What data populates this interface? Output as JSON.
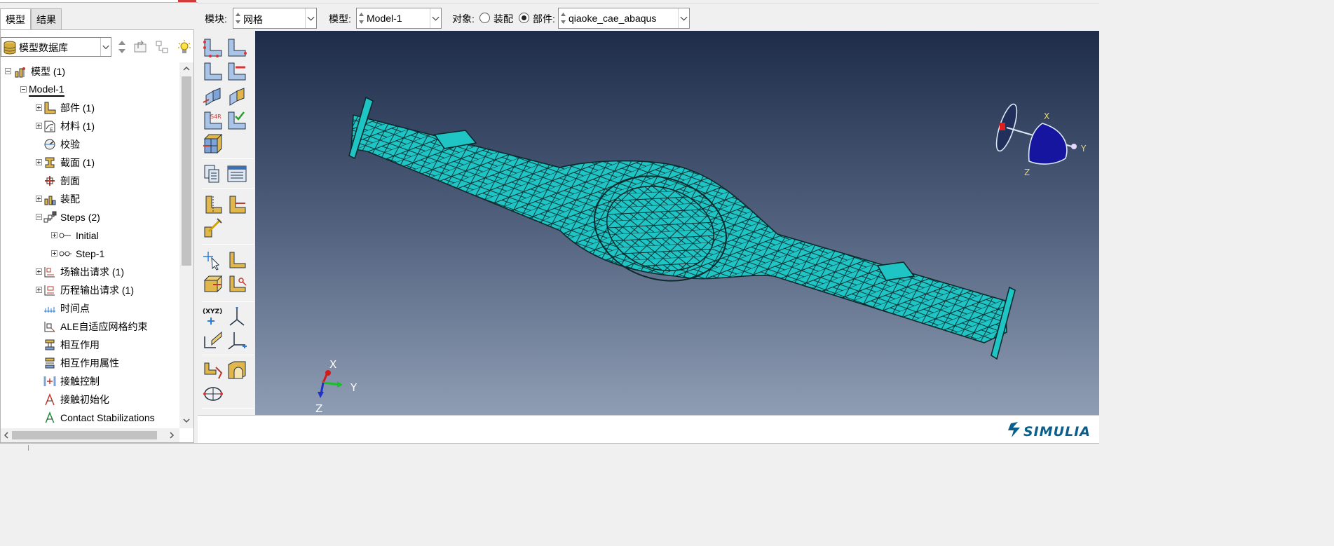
{
  "left_tabs": [
    {
      "label": "模型",
      "active": true
    },
    {
      "label": "结果",
      "active": false
    }
  ],
  "model_db": {
    "label": "模型数据库"
  },
  "tree": {
    "items": [
      {
        "label": "模型 (1)",
        "icon": "models-icon",
        "toggle": "minus"
      },
      {
        "label": "Model-1",
        "icon": "",
        "toggle": "minus"
      },
      {
        "label": "部件 (1)",
        "icon": "parts-icon",
        "toggle": "plus"
      },
      {
        "label": "材料 (1)",
        "icon": "materials-icon",
        "toggle": "plus"
      },
      {
        "label": "校验",
        "icon": "calibration-icon",
        "toggle": ""
      },
      {
        "label": "截面 (1)",
        "icon": "sections-icon",
        "toggle": "plus"
      },
      {
        "label": "剖面",
        "icon": "profiles-icon",
        "toggle": ""
      },
      {
        "label": "装配",
        "icon": "assembly-icon",
        "toggle": "plus"
      },
      {
        "label": "Steps (2)",
        "icon": "steps-icon",
        "toggle": "minus"
      },
      {
        "label": "Initial",
        "icon": "initial-step-icon",
        "toggle": "plus"
      },
      {
        "label": "Step-1",
        "icon": "step-icon",
        "toggle": "plus"
      },
      {
        "label": "场输出请求 (1)",
        "icon": "field-output-icon",
        "toggle": "plus"
      },
      {
        "label": "历程输出请求 (1)",
        "icon": "history-output-icon",
        "toggle": "plus"
      },
      {
        "label": "时间点",
        "icon": "time-points-icon",
        "toggle": ""
      },
      {
        "label": "ALE自适应网格约束",
        "icon": "ale-constraint-icon",
        "toggle": ""
      },
      {
        "label": "相互作用",
        "icon": "interaction-icon",
        "toggle": ""
      },
      {
        "label": "相互作用属性",
        "icon": "interaction-property-icon",
        "toggle": ""
      },
      {
        "label": "接触控制",
        "icon": "contact-controls-icon",
        "toggle": ""
      },
      {
        "label": "接触初始化",
        "icon": "contact-initialization-icon",
        "toggle": ""
      },
      {
        "label": "Contact Stabilizations",
        "icon": "contact-stabilization-icon",
        "toggle": ""
      }
    ]
  },
  "context_bar": {
    "module_label": "模块:",
    "module_value": "网格",
    "model_label": "模型:",
    "model_value": "Model-1",
    "object_label": "对象:",
    "assembly_label": "装配",
    "part_label": "部件:",
    "part_value": "qiaoke_cae_abaqus",
    "object_selected": "part"
  },
  "viewport": {
    "background_top": "#1e2c49",
    "background_bottom": "#8f9db4",
    "mesh_color": "#1fc4c4",
    "mesh_line_color": "#0b2a2c",
    "triad": {
      "x": "X",
      "y": "Y",
      "z": "Z"
    },
    "view_cube": {
      "x": "X",
      "y": "Y",
      "z": "Z"
    }
  },
  "brand": {
    "text": "SIMULIA",
    "color": "#0a5e8c"
  }
}
